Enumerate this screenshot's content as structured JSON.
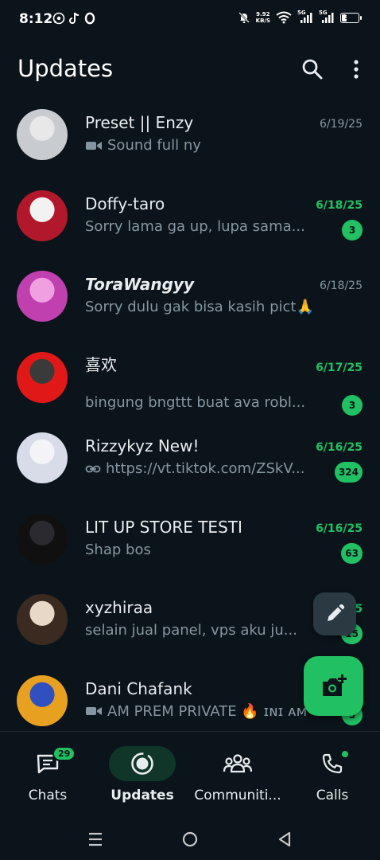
{
  "status_bar": {
    "time": "8:12",
    "net_speed_value": "9.92",
    "net_speed_unit": "KB/S",
    "sim1": "5G",
    "sim2": "5G",
    "battery": "31",
    "battery_level": 0.31
  },
  "header": {
    "title": "Updates"
  },
  "chats": [
    {
      "name": "Preset || Enzy",
      "preview": "Sound full ny",
      "preview_icon": "video-icon",
      "date": "6/19/25",
      "unread": null,
      "date_green": false,
      "avatar_colors": [
        "#c8ccd0",
        "#e8e8e8"
      ]
    },
    {
      "name": "Doffy-taro",
      "preview": "Sorry lama ga up, lupa sama...",
      "preview_icon": null,
      "date": "6/18/25",
      "unread": "3",
      "date_green": true,
      "avatar_colors": [
        "#b2182b",
        "#f2f2f2"
      ]
    },
    {
      "name": "ToraWangyy",
      "preview": "Sorry dulu gak bisa kasih pict🙏",
      "preview_icon": null,
      "date": "6/18/25",
      "unread": null,
      "date_green": false,
      "avatar_colors": [
        "#c040b0",
        "#f0a0e0"
      ]
    },
    {
      "name": "喜欢",
      "name_prefix": "ٜ",
      "preview": "bingung bngttt buat ava robl...",
      "preview_icon": null,
      "date": "6/17/25",
      "unread": "3",
      "date_green": true,
      "avatar_colors": [
        "#e01818",
        "#3a3a3a"
      ]
    },
    {
      "name": "Rizzykyz New!",
      "preview": "https://vt.tiktok.com/ZSkV...",
      "preview_icon": "link-icon",
      "date": "6/16/25",
      "unread": "324",
      "date_green": true,
      "avatar_colors": [
        "#d8dce8",
        "#f4f4f8"
      ]
    },
    {
      "name": "LIT UP STORE TESTI",
      "preview": "Shap bos",
      "preview_icon": null,
      "date": "6/16/25",
      "unread": "63",
      "date_green": true,
      "avatar_colors": [
        "#101010",
        "#2a2a30"
      ]
    },
    {
      "name": "xyzhiraa",
      "preview": "selain jual panel, vps aku ju...",
      "preview_icon": null,
      "date": "6/16/25",
      "unread": "15",
      "date_green": true,
      "avatar_colors": [
        "#3a2a20",
        "#e8d8c8"
      ]
    },
    {
      "name": "Dani Chafank",
      "preview": "AM PREM PRIVATE 🔥 ɪɴɪ ᴀᴍ",
      "preview_icon": "video-icon",
      "date": "6/16/25",
      "unread": "5",
      "date_green": true,
      "avatar_colors": [
        "#e8a020",
        "#3050c0"
      ]
    }
  ],
  "bottom_nav": {
    "items": [
      {
        "label": "Chats",
        "badge": "29",
        "active": false
      },
      {
        "label": "Updates",
        "active": true
      },
      {
        "label": "Communiti...",
        "active": false
      },
      {
        "label": "Calls",
        "dot": true,
        "active": false
      }
    ]
  },
  "colors": {
    "background": "#0b141a",
    "accent": "#21c063",
    "secondary_text": "#8696a0",
    "primary_text": "#e9edef"
  },
  "icons": {
    "search": "search-icon",
    "menu": "more-vertical-icon",
    "edit": "pencil-icon",
    "camera": "camera-add-icon"
  }
}
